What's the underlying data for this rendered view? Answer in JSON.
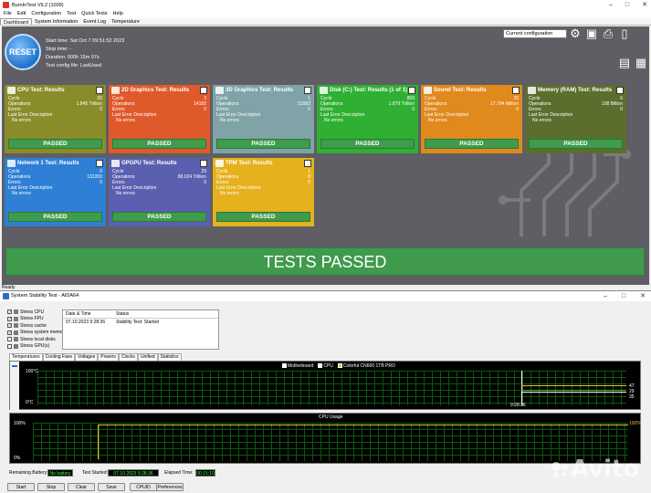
{
  "bit": {
    "title": "BurnInTest V9.2 (1009)",
    "menu": [
      "File",
      "Edit",
      "Configuration",
      "Test",
      "Quick Tests",
      "Help"
    ],
    "tabs": [
      "Dashboard",
      "System Information",
      "Event Log",
      "Temperature"
    ],
    "reset_label": "RESET",
    "start_time": "Start time: Sat Oct  7 09:51:52 2023",
    "stop_time": "Stop time: -",
    "duration": "Duration: 000h 15m 07s",
    "config_file": "Test config file: LastUsed",
    "config_select": "Current configuration",
    "cards": [
      {
        "title": "CPU Test: Results",
        "cycle": "50",
        "ops": "1.845 Trillion",
        "errors": "0",
        "color": "#8a8c2a"
      },
      {
        "title": "2D Graphics Test: Results",
        "cycle": "3",
        "ops": "14182",
        "errors": "0",
        "color": "#e0592a"
      },
      {
        "title": "3D Graphics Test: Results",
        "cycle": "1",
        "ops": "51082",
        "errors": "0",
        "color": "#7fa3a6"
      },
      {
        "title": "Disk (C:) Test: Results (1 of 1)",
        "cycle": "859",
        "ops": "1.879 Trillion",
        "errors": "0",
        "color": "#2fb032"
      },
      {
        "title": "Sound Test: Results",
        "cycle": "25",
        "ops": "17.794 Million",
        "errors": "0",
        "color": "#e0891c"
      },
      {
        "title": "Memory (RAM) Test: Results",
        "cycle": "6",
        "ops": "108 Billion",
        "errors": "0",
        "color": "#5b6e2e"
      },
      {
        "title": "Network 1 Test: Results",
        "cycle": "0",
        "ops": "131200",
        "errors": "0",
        "color": "#2f7fd6"
      },
      {
        "title": "GPGPU Test: Results",
        "cycle": "29",
        "ops": "88.024 Trillion",
        "errors": "0",
        "color": "#5b5fb0"
      },
      {
        "title": "TPM Test: Results",
        "cycle": "1",
        "ops": "8",
        "errors": "0",
        "color": "#e6b11c"
      }
    ],
    "labels": {
      "cycle": "Cycle",
      "ops": "Operations",
      "errors": "Errors",
      "last_err": "Last Error Description",
      "no_errors": "No errors",
      "passed": "PASSED"
    },
    "tests_passed": "TESTS PASSED",
    "status": "Ready"
  },
  "aida": {
    "title": "System Stability Test - AIDA64",
    "stress": [
      {
        "label": "Stress CPU",
        "checked": true
      },
      {
        "label": "Stress FPU",
        "checked": true
      },
      {
        "label": "Stress cache",
        "checked": true
      },
      {
        "label": "Stress system memory",
        "checked": true
      },
      {
        "label": "Stress local disks",
        "checked": false
      },
      {
        "label": "Stress GPU(s)",
        "checked": false
      }
    ],
    "log_headers": [
      "Date & Time",
      "Status"
    ],
    "log_row": {
      "time": "07.10.2023 9:28:36",
      "status": "Stability Test: Started"
    },
    "subtabs": [
      "Temperatures",
      "Cooling Fans",
      "Voltages",
      "Powers",
      "Clocks",
      "Unified",
      "Statistics"
    ],
    "temp_graph": {
      "legend": [
        "Motherboard",
        "CPU",
        "Colorful CN600 1TB PRO"
      ],
      "y_top": "100°C",
      "y_bottom": "0°C",
      "time": "9:28:36",
      "right_val_1": "47",
      "right_val_2": "29",
      "right_val_3": "35"
    },
    "cpu_graph": {
      "title": "CPU Usage",
      "y_top": "100%",
      "y_bottom": "0%",
      "right_val": "100%"
    },
    "battery_label": "Remaining Battery:",
    "battery_value": "No battery",
    "started_label": "Test Started:",
    "started_value": "07.10.2023 9:28:36",
    "elapsed_label": "Elapsed Time:",
    "elapsed_value": "00:15:10",
    "buttons": [
      "Start",
      "Stop",
      "Clear",
      "Save",
      "CPUID",
      "Preferences"
    ]
  },
  "watermark": "Avito"
}
